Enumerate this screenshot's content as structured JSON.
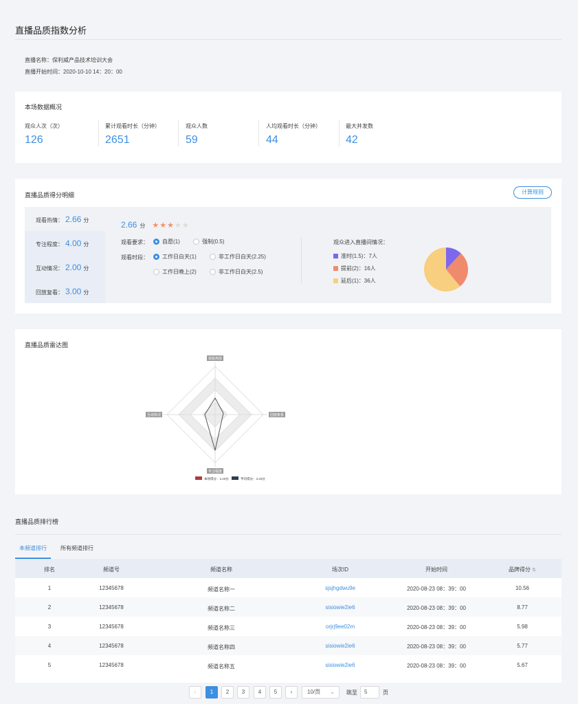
{
  "page": {
    "title": "直播品质指数分析"
  },
  "meta": {
    "name": "直播名称：保利威产品技术培训大会",
    "start": "直播开始时间：2020-10-10  14：20：00"
  },
  "overview": {
    "title": "本场数据概况",
    "stats": [
      {
        "label": "观众人次（次）",
        "value": "126"
      },
      {
        "label": "累计观看时长（分钟）",
        "value": "2651"
      },
      {
        "label": "观众人数",
        "value": "59"
      },
      {
        "label": "人均观看时长（分钟）",
        "value": "44"
      },
      {
        "label": "最大并发数",
        "value": "42"
      }
    ]
  },
  "detail": {
    "title": "直播品质得分明细",
    "button": "计算规则",
    "left_items": [
      {
        "label": "观看热情：",
        "value": "2.66",
        "unit": "分"
      },
      {
        "label": "专注程度：",
        "value": "4.00",
        "unit": "分"
      },
      {
        "label": "互动情况：",
        "value": "2.00",
        "unit": "分"
      },
      {
        "label": "回放复看：",
        "value": "3.00",
        "unit": "分"
      }
    ],
    "score": "2.66",
    "score_unit": "分",
    "rating": {
      "value": 3,
      "max": 5
    },
    "req_label": "观看要求：",
    "req_options": [
      {
        "label": "自愿(1)",
        "selected": true
      },
      {
        "label": "强制(0.5)",
        "selected": false
      }
    ],
    "period_label": "观看时段：",
    "period_options": [
      {
        "label": "工作日白天(1)",
        "selected": true
      },
      {
        "label": "非工作日白天(2.25)",
        "selected": false
      },
      {
        "label": "工作日晚上(2)",
        "selected": false
      },
      {
        "label": "非工作日白天(2.5)",
        "selected": false
      }
    ],
    "entry_title": "观众进入直播间情况：",
    "entry_legend": [
      {
        "label": "准时(1.5)：7人",
        "value": 7,
        "color": "#7b68ee"
      },
      {
        "label": "提前(2)：16人",
        "value": 16,
        "color": "#f08a6c"
      },
      {
        "label": "延后(1)：36人",
        "value": 36,
        "color": "#f7cf7e"
      }
    ]
  },
  "radar": {
    "title": "直播品质雷达图",
    "axes": [
      "观看热情",
      "专注程度",
      "回放复看",
      "互动情况"
    ],
    "legend": [
      {
        "label": "本场得分：3.20分",
        "color": "#b03a3a"
      },
      {
        "label": "平均得分：3.20分",
        "color": "#2d3e50"
      }
    ]
  },
  "ranking": {
    "title": "直播品质排行榜",
    "tabs": [
      {
        "label": "本频道排行",
        "active": true
      },
      {
        "label": "所有频道排行",
        "active": false
      }
    ],
    "columns": [
      "排名",
      "频道号",
      "频道名称",
      "场次ID",
      "开始时间",
      "品牌得分"
    ],
    "rows": [
      {
        "rank": "1",
        "channel": "12345678",
        "name": "频道名称一",
        "sid": "sjsjhgdwu9e",
        "time": "2020-08-23   08：39：00",
        "score": "10.56"
      },
      {
        "rank": "2",
        "channel": "12345678",
        "name": "频道名称二",
        "sid": "sisiowie2ie6",
        "time": "2020-08-23   08：39：00",
        "score": "8.77"
      },
      {
        "rank": "3",
        "channel": "12345678",
        "name": "频道名称三",
        "sid": "orjrj9ee02m",
        "time": "2020-08-23   08：39：00",
        "score": "5.98"
      },
      {
        "rank": "4",
        "channel": "12345678",
        "name": "频道名称四",
        "sid": "sisiowie2ie6",
        "time": "2020-08-23   08：39：00",
        "score": "5.77"
      },
      {
        "rank": "5",
        "channel": "12345678",
        "name": "频道名称五",
        "sid": "sisiowie2ie6",
        "time": "2020-08-23   08：39：00",
        "score": "5.67"
      }
    ]
  },
  "pagination": {
    "prev": "‹",
    "next": "›",
    "pages": [
      "1",
      "2",
      "3",
      "4",
      "5"
    ],
    "current": "1",
    "page_size": "10/页",
    "jump_label": "跳至",
    "jump_value": "5",
    "jump_unit": "页"
  },
  "colors": {
    "accent": "#3d8fe0"
  }
}
